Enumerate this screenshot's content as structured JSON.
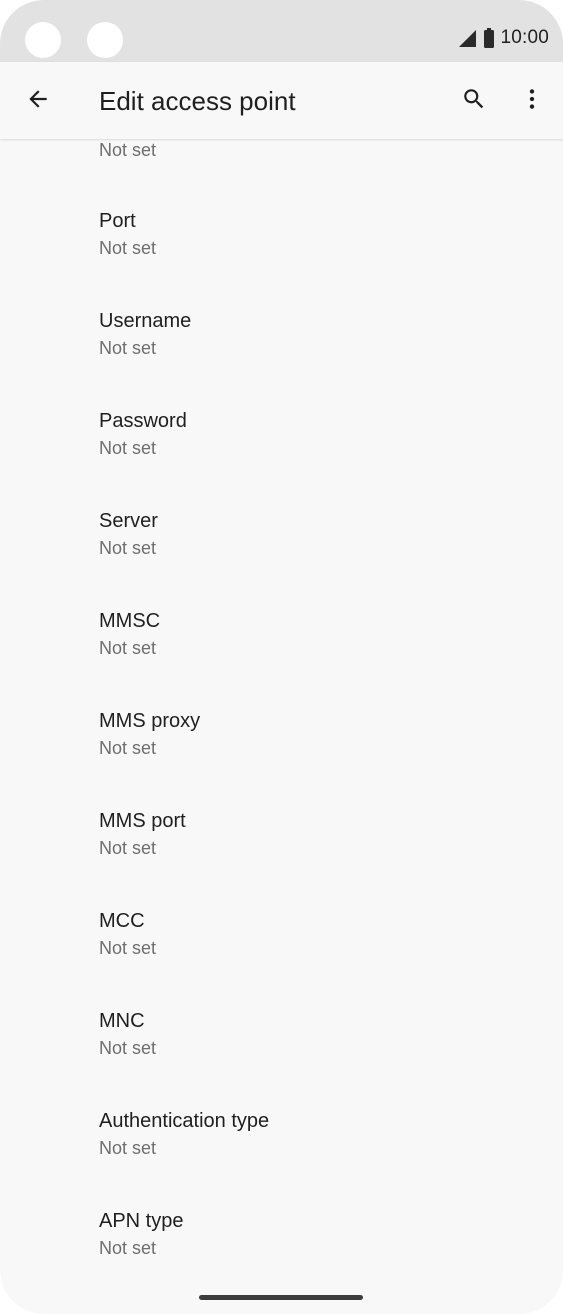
{
  "status_bar": {
    "time": "10:00",
    "icons": [
      "signal-icon",
      "battery-icon"
    ]
  },
  "toolbar": {
    "title": "Edit access point",
    "icons": [
      "back-arrow-icon",
      "search-icon",
      "more-vert-icon"
    ]
  },
  "settings": {
    "partial_item_summary": "Not set",
    "items": [
      {
        "title": "Port",
        "summary": "Not set"
      },
      {
        "title": "Username",
        "summary": "Not set"
      },
      {
        "title": "Password",
        "summary": "Not set"
      },
      {
        "title": "Server",
        "summary": "Not set"
      },
      {
        "title": "MMSC",
        "summary": "Not set"
      },
      {
        "title": "MMS proxy",
        "summary": "Not set"
      },
      {
        "title": "MMS port",
        "summary": "Not set"
      },
      {
        "title": "MCC",
        "summary": "Not set"
      },
      {
        "title": "MNC",
        "summary": "Not set"
      },
      {
        "title": "Authentication type",
        "summary": "Not set"
      },
      {
        "title": "APN type",
        "summary": "Not set"
      }
    ]
  },
  "colors": {
    "status_bar_bg": "#e2e2e2",
    "background": "#f8f8f8",
    "title_text": "#1f1f1f",
    "summary_text": "#6e6e6e"
  }
}
